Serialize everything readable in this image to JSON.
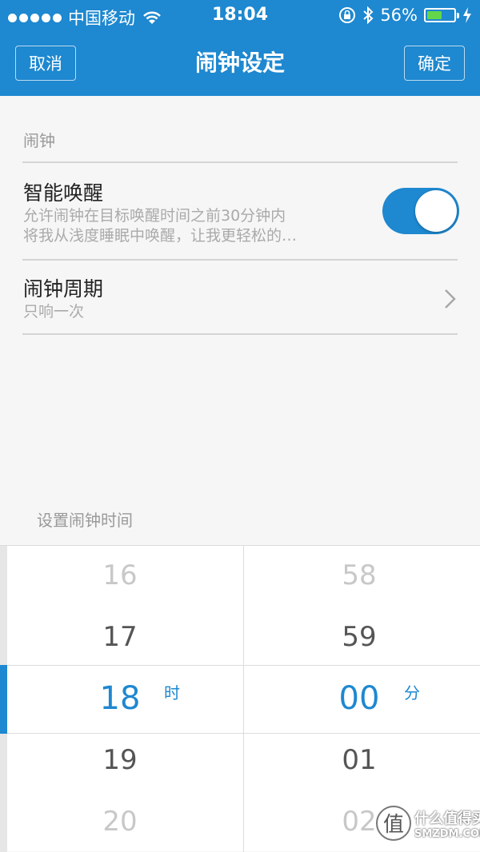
{
  "status_bar": {
    "carrier": "中国移动",
    "time": "18:04",
    "battery_percent_text": "56%",
    "battery_level": 0.56
  },
  "nav": {
    "cancel_label": "取消",
    "title": "闹钟设定",
    "confirm_label": "确定"
  },
  "section": {
    "header": "闹钟"
  },
  "smart_wake": {
    "title": "智能唤醒",
    "desc_line1": "允许闹钟在目标唤醒时间之前30分钟内",
    "desc_line2": "将我从浅度睡眠中唤醒，让我更轻松的…",
    "enabled": true
  },
  "alarm_period": {
    "title": "闹钟周期",
    "value": "只响一次"
  },
  "picker": {
    "label": "设置闹钟时间",
    "hours": [
      "16",
      "17",
      "18",
      "19",
      "20"
    ],
    "hour_unit": "时",
    "minutes": [
      "58",
      "59",
      "00",
      "01",
      "02"
    ],
    "minute_unit": "分",
    "selected_hour": "18",
    "selected_minute": "00"
  },
  "watermark": {
    "cn": "什么值得买",
    "en": "SMZDM.COM",
    "badge": "值"
  },
  "colors": {
    "accent": "#1e88d0",
    "switch_on": "#1e88d0",
    "battery_fill": "#63d64a"
  },
  "icons": {
    "signal": "signal-dots-icon",
    "wifi": "wifi-icon",
    "lock_rotation": "rotation-lock-icon",
    "bluetooth": "bluetooth-icon",
    "battery": "battery-icon",
    "charging": "charging-bolt-icon",
    "chevron": "chevron-right-icon"
  }
}
